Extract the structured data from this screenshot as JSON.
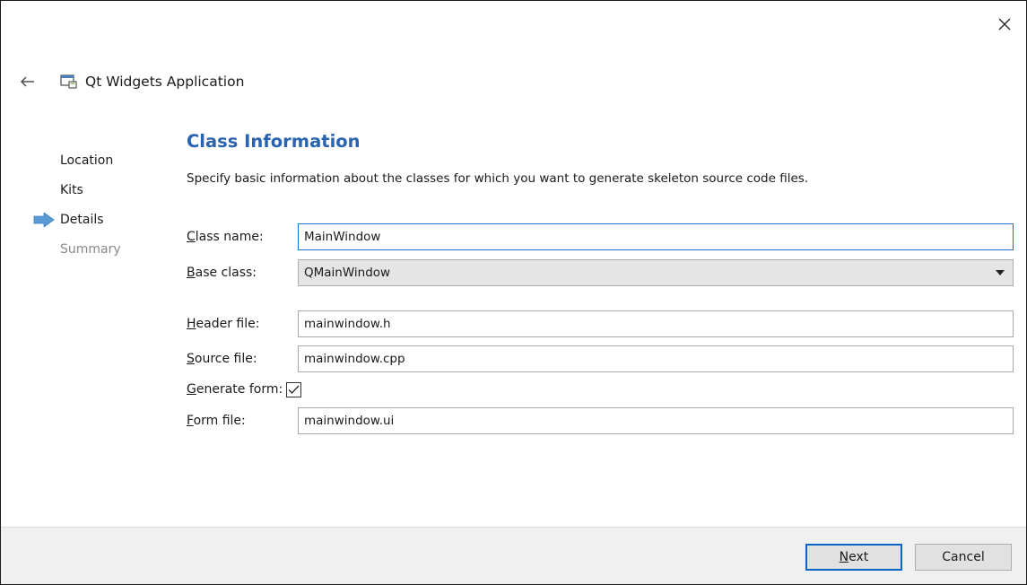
{
  "window": {
    "title": "Qt Widgets Application",
    "close_icon": "close-icon",
    "back_icon": "back-arrow-icon",
    "app_icon": "qt-window-icon"
  },
  "steps": [
    {
      "label": "Location",
      "state": "done"
    },
    {
      "label": "Kits",
      "state": "done"
    },
    {
      "label": "Details",
      "state": "current"
    },
    {
      "label": "Summary",
      "state": "pending"
    }
  ],
  "main": {
    "section_title": "Class Information",
    "description": "Specify basic information about the classes for which you want to generate skeleton source code files."
  },
  "form": {
    "class_name": {
      "mnemonic": "C",
      "label_rest": "lass name:",
      "value": "MainWindow"
    },
    "base_class": {
      "mnemonic": "B",
      "label_rest": "ase class:",
      "value": "QMainWindow"
    },
    "header_file": {
      "mnemonic": "H",
      "label_rest": "eader file:",
      "value": "mainwindow.h"
    },
    "source_file": {
      "mnemonic": "S",
      "label_rest": "ource file:",
      "value": "mainwindow.cpp"
    },
    "generate_form": {
      "mnemonic": "G",
      "label_rest": "enerate form:",
      "checked": true
    },
    "form_file": {
      "mnemonic": "F",
      "label_rest": "orm file:",
      "value": "mainwindow.ui"
    }
  },
  "footer": {
    "next": {
      "mnemonic": "N",
      "label_rest": "ext"
    },
    "cancel_label": "Cancel"
  },
  "colors": {
    "accent": "#2a63b0",
    "focus_border": "#1f6fd1",
    "step_arrow": "#5b9bd5",
    "primary_button_border": "#0a64c8"
  }
}
